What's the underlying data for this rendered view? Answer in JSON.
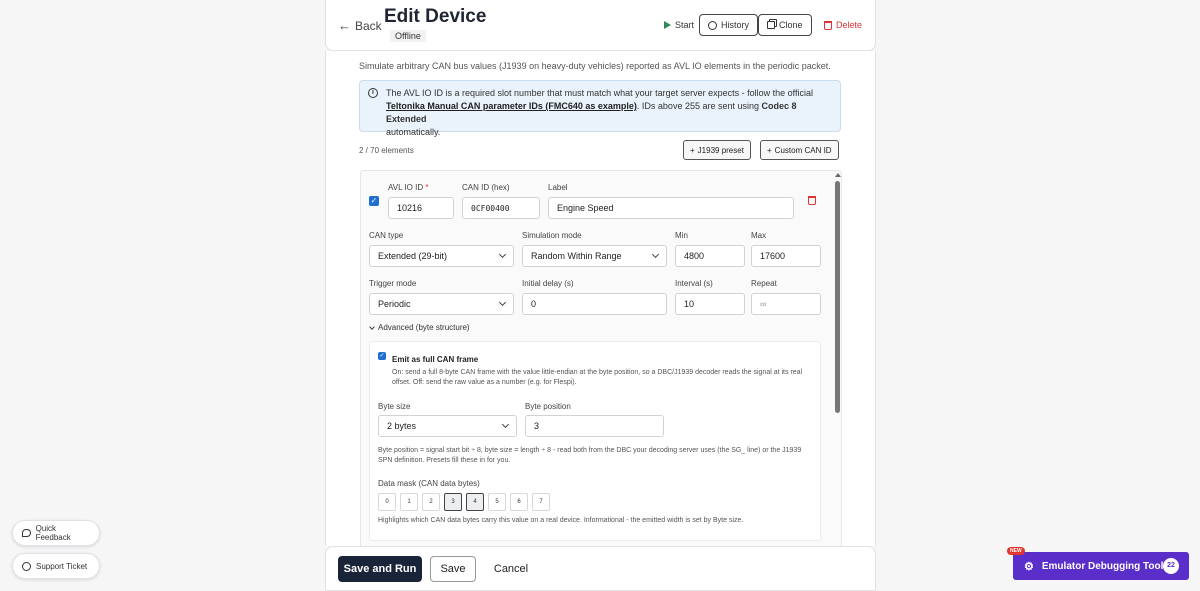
{
  "header": {
    "back_label": "Back",
    "title": "Edit Device",
    "status": "Offline",
    "start_label": "Start",
    "history_label": "History",
    "clone_label": "Clone",
    "delete_label": "Delete"
  },
  "section": {
    "intro": "Simulate arbitrary CAN bus values (J1939 on heavy-duty vehicles) reported as AVL IO elements in the periodic packet.",
    "info_part1": "The AVL IO ID is a required slot number that must match what your target server expects - follow the official",
    "info_link": "Teltonika Manual CAN parameter IDs (FMC640 as example)",
    "info_part2": ". IDs above 255 are sent using",
    "info_bold": "Codec 8 Extended",
    "info_part3": "automatically.",
    "count": "2 / 70 elements",
    "j1939_label": "J1939 preset",
    "custom_label": "Custom CAN ID"
  },
  "element": {
    "avl_label": "AVL IO ID",
    "avl_required": "*",
    "avl_value": "10216",
    "can_id_label": "CAN ID (hex)",
    "can_id_value": "0CF00400",
    "label_label": "Label",
    "label_value": "Engine Speed",
    "can_type_label": "CAN type",
    "can_type_value": "Extended (29-bit)",
    "sim_mode_label": "Simulation mode",
    "sim_mode_value": "Random Within Range",
    "min_label": "Min",
    "min_value": "4800",
    "max_label": "Max",
    "max_value": "17600",
    "trigger_label": "Trigger mode",
    "trigger_value": "Periodic",
    "delay_label": "Initial delay (s)",
    "delay_value": "0",
    "interval_label": "Interval (s)",
    "interval_value": "10",
    "repeat_label": "Repeat",
    "repeat_placeholder": "∞",
    "advanced_label": "Advanced (byte structure)",
    "emit_title": "Emit as full CAN frame",
    "emit_desc": "On: send a full 8-byte CAN frame with the value little-endian at the byte position, so a DBC/J1939 decoder reads the signal at its real offset. Off: send the raw value as a number (e.g. for Flespi).",
    "byte_size_label": "Byte size",
    "byte_size_value": "2 bytes",
    "byte_pos_label": "Byte position",
    "byte_pos_value": "3",
    "byte_help": "Byte position = signal start bit ÷ 8, byte size = length ÷ 8 - read both from the DBC your decoding server uses (the SG_ line) or the J1939 SPN definition. Presets fill these in for you.",
    "mask_label": "Data mask (CAN data bytes)",
    "mask_bytes": [
      "0",
      "1",
      "2",
      "3",
      "4",
      "5",
      "6",
      "7"
    ],
    "mask_active": [
      3,
      4
    ],
    "mask_help": "Highlights which CAN data bytes carry this value on a real device. Informational - the emitted width is set by Byte size."
  },
  "footer": {
    "save_run_label": "Save and Run",
    "save_label": "Save",
    "cancel_label": "Cancel"
  },
  "widgets": {
    "quick_feedback": "Quick Feedback",
    "support_ticket": "Support Ticket",
    "emulator_label": "Emulator Debugging Tool",
    "emulator_badge": "22",
    "new_badge": "NEW"
  },
  "colors": {
    "primary_dark": "#1a2438",
    "accent_purple": "#5a2ec9",
    "danger": "#dd3333",
    "checkbox_blue": "#1f6fd0"
  }
}
